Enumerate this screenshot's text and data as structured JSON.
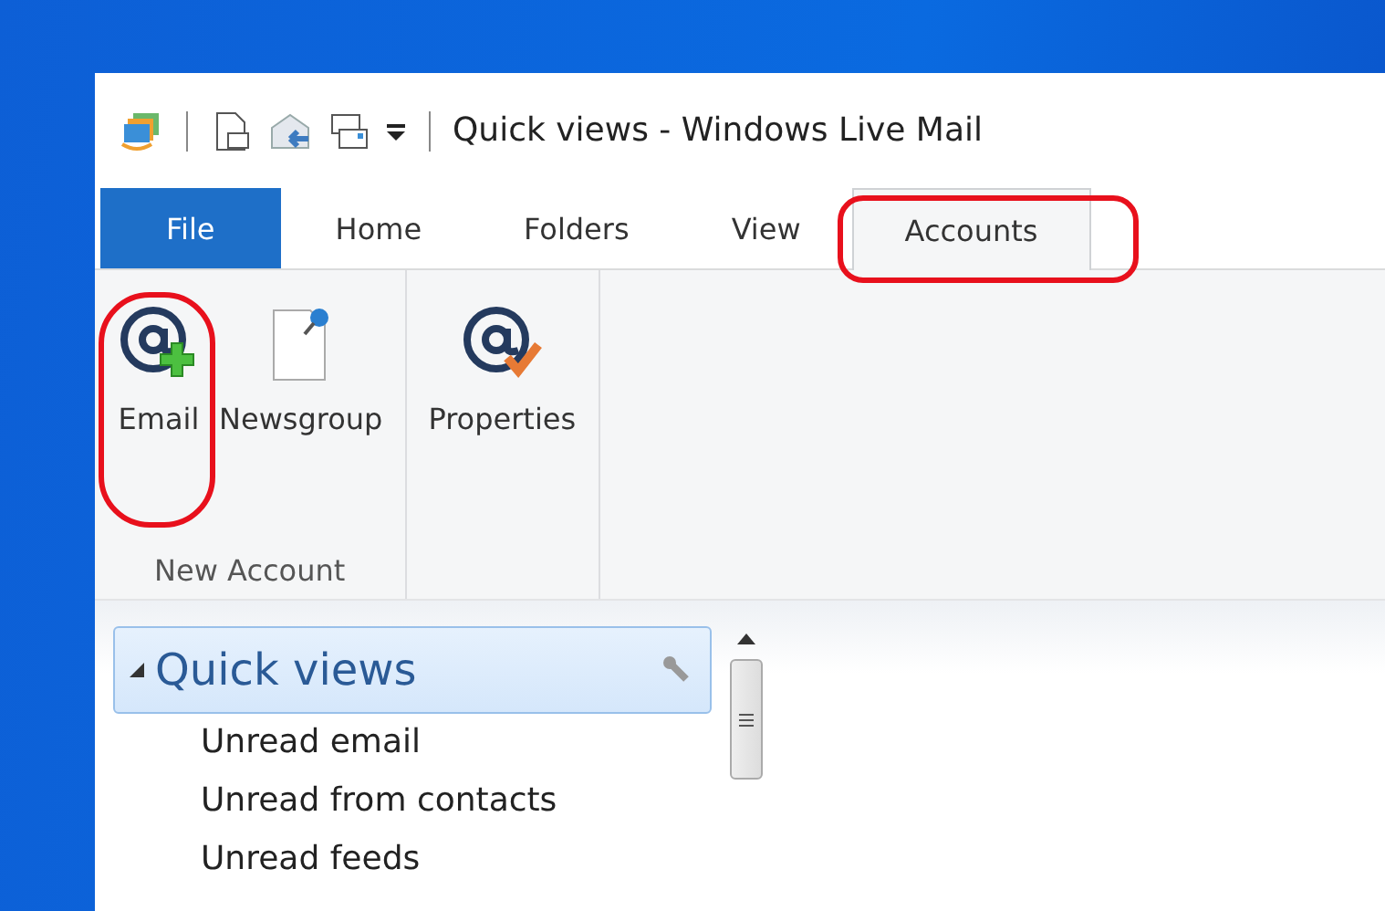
{
  "window": {
    "title": "Quick views - Windows Live Mail"
  },
  "tabs": [
    {
      "label": "File",
      "kind": "file",
      "selected": false,
      "highlighted": false
    },
    {
      "label": "Home",
      "kind": "tab",
      "selected": false,
      "highlighted": false
    },
    {
      "label": "Folders",
      "kind": "tab",
      "selected": false,
      "highlighted": false
    },
    {
      "label": "View",
      "kind": "tab",
      "selected": false,
      "highlighted": false
    },
    {
      "label": "Accounts",
      "kind": "tab",
      "selected": true,
      "highlighted": true
    }
  ],
  "ribbon_groups": [
    {
      "label": "New Account",
      "buttons": [
        {
          "label": "Email",
          "kind": "at-plus",
          "highlighted": true
        },
        {
          "label": "Newsgroup",
          "kind": "pin-page",
          "highlighted": false
        }
      ]
    },
    {
      "buttons": [
        {
          "label": "Properties",
          "kind": "at-check",
          "highlighted": false
        }
      ]
    }
  ],
  "folder_pane": {
    "header": {
      "label": "Quick views",
      "expanded": true
    },
    "items": [
      {
        "label": "Unread email"
      },
      {
        "label": "Unread from contacts"
      },
      {
        "label": "Unread feeds"
      }
    ]
  }
}
